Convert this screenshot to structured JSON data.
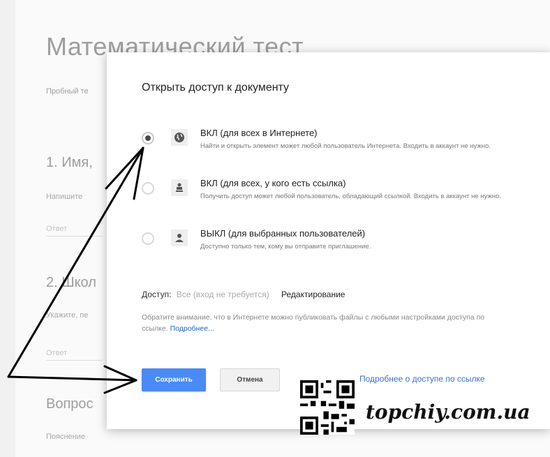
{
  "background": {
    "form_title": "Математический тест",
    "form_desc": "Пробный те",
    "q1_title": "1. Имя,",
    "q1_hint": "Напишите",
    "q1_input": "Ответ",
    "q2_title": "2. Школ",
    "q2_hint": "Укажите, пе",
    "q2_input": "Ответ",
    "q3_title": "Вопрос",
    "q3_hint": "Пояснение"
  },
  "dialog": {
    "title": "Открыть доступ к документу",
    "options": [
      {
        "label": "ВКЛ (для всех в Интернете)",
        "desc": "Найти и открыть элемент может любой пользователь Интернета. Входить в аккаунт не нужно.",
        "checked": true,
        "icon": "globe-icon"
      },
      {
        "label": "ВКЛ (для всех, у кого есть ссылка)",
        "desc": "Получить доступ может любой пользователь, обладающий ссылкой. Входить в аккаунт не нужно.",
        "checked": false,
        "icon": "people-icon"
      },
      {
        "label": "ВЫКЛ (для выбранных пользователей)",
        "desc": "Доступно только тем, кому вы отправите приглашение.",
        "checked": false,
        "icon": "person-icon"
      }
    ],
    "access_label": "Доступ:",
    "access_value": "Все (вход не требуется)",
    "access_mode": "Редактирование",
    "note_text": "Обратите внимание, что в Интернете можно публиковать файлы с любыми настройками доступа по ссылке.",
    "note_link": "Подробнее...",
    "save_label": "Сохранить",
    "cancel_label": "Отмена",
    "more_link": "Подробнее о доступе по ссылке"
  },
  "watermark": "topchiy.com.ua",
  "colors": {
    "save_button": "#4a8af4",
    "link": "#3c6fd1"
  }
}
